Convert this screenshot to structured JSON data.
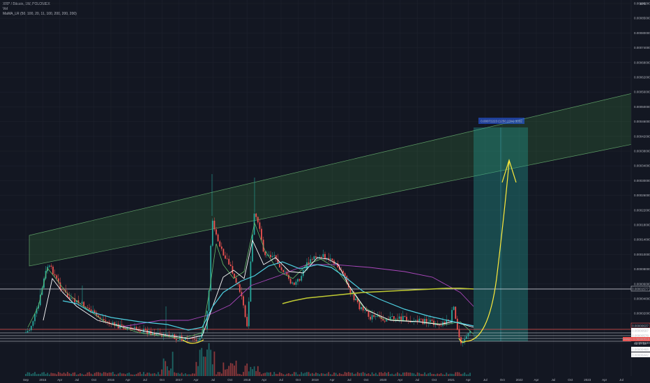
{
  "header": {
    "symbol_line": "XRP / Bitcoin, 1W, POLONIEX",
    "indicator_1": "Vol",
    "indicator_2": "MaMA_LR (50, 100, 20, 11, 100, 200, 200, 200)"
  },
  "currency_label": "BTC",
  "measure_label": "0.00072223 (1250.23%) 3032",
  "badges": {
    "upper_level": "0.00001577",
    "red_level": "0.00000637",
    "current_price": "0.00000516",
    "current_symbol": "XRPBTC",
    "countdown": "6d 17:18",
    "level_a": "0.00000597",
    "level_b": "0.00000578",
    "level_c": "0.00000468",
    "level_d": "0.00000442"
  },
  "colors": {
    "background": "#131722",
    "channel_fill": "#4caf50",
    "projection_fill": "#26a69a",
    "up_candle": "#26a69a",
    "down_candle": "#ef5350",
    "ma_white": "#ffffff",
    "ma_cyan": "#4dd0e1",
    "ma_green": "#66bb6a",
    "ma_purple": "#ab47bc",
    "ma_olive": "#c0ca33",
    "drawing_yellow": "#ffeb3b"
  },
  "chart_data": {
    "type": "candlestick",
    "price_scale": "log",
    "x_ticks": [
      "Sep",
      "2015",
      "Apr",
      "Jul",
      "Oct",
      "2016",
      "Apr",
      "Jul",
      "Oct",
      "2017",
      "Apr",
      "Jul",
      "Oct",
      "2018",
      "Apr",
      "Jul",
      "Oct",
      "2019",
      "Apr",
      "Jul",
      "Oct",
      "2020",
      "Apr",
      "Jul",
      "Oct",
      "2021",
      "Apr",
      "Jul",
      "Oct",
      "2022",
      "Apr",
      "Jul",
      "Oct",
      "2023",
      "Apr",
      "Jul"
    ],
    "y_ticks": [
      "0.00095000",
      "0.00085000",
      "0.00080000",
      "0.00074000",
      "0.00068000",
      "0.00062000",
      "0.00056000",
      "0.00050000",
      "0.00046000",
      "0.00042000",
      "0.00038000",
      "0.00034000",
      "0.00030000",
      "0.00026000",
      "0.00022000",
      "0.00018000",
      "0.00014000",
      "0.00010000",
      "0.00008000",
      "0.00006000",
      "0.00004000",
      "0.00002000",
      "0.00000000",
      "-0.00001000"
    ],
    "horizontal_levels": [
      "0.00001577",
      "0.00000637",
      "0.00000597",
      "0.00000578",
      "0.00000468",
      "0.00000442"
    ],
    "projection_target": "0.00072223",
    "projection_change": "1250.23%",
    "projection_bars": "3032"
  }
}
